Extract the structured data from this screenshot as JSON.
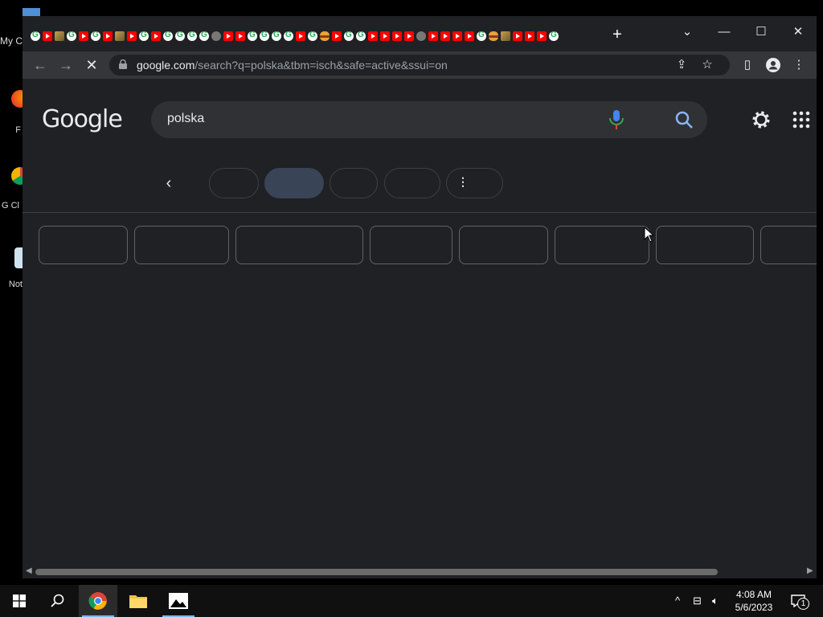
{
  "desktop": {
    "icons": [
      {
        "label": "My C",
        "top": "partial"
      },
      {
        "label": "F"
      },
      {
        "label": "G Cl"
      },
      {
        "label": "Not"
      }
    ]
  },
  "browser": {
    "url_host": "google.com",
    "url_path": "/search?q=polska&tbm=isch&safe=active&ssui=on",
    "new_tab_label": "+",
    "tab_count_note": ""
  },
  "search": {
    "logo_text": "Google",
    "query": "polska"
  },
  "chips": {
    "more_label": "⋮"
  },
  "taskbar": {
    "time": "4:08 AM",
    "date": "5/6/2023",
    "notification_count": "1"
  },
  "colors": {
    "background": "#202124",
    "toolbar": "#35363a",
    "search_box": "#303134",
    "active_chip": "#394457",
    "accent_blue": "#8ab4f8"
  }
}
